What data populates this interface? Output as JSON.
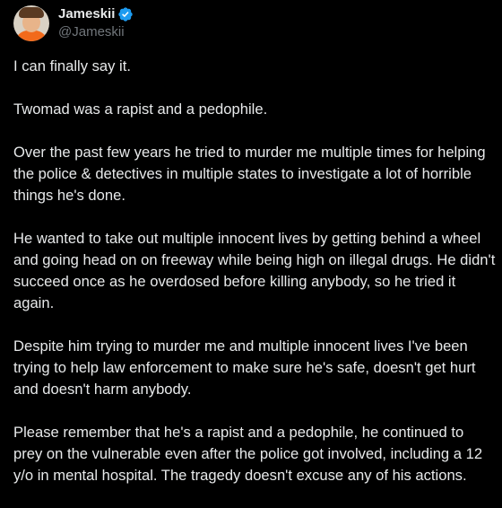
{
  "author": {
    "display_name": "Jameskii",
    "handle": "@Jameskii",
    "verified_icon": "verified-badge-icon",
    "verified_color": "#1d9bf0"
  },
  "tweet": {
    "paragraphs": [
      [
        "I can finally say it."
      ],
      [
        "Twomad was a rapist and a pedophile."
      ],
      [
        "Over the past few years he tried to murder me multiple times for helping",
        "the police & detectives in multiple states to investigate a lot of horrible",
        "things he's done."
      ],
      [
        "He wanted to take out multiple innocent lives by getting behind a wheel",
        "and going head on on freeway while being high on illegal drugs. He didn't",
        "succeed once as he overdosed before killing anybody, so he tried it",
        "again."
      ],
      [
        "Despite him trying to murder me and multiple innocent lives I've been",
        "trying to help law enforcement to make sure he's safe, doesn't get hurt",
        "and doesn't harm anybody."
      ],
      [
        "Please remember that he's a rapist and a pedophile, he continued to",
        "prey on the vulnerable even after the police got involved, including a 12",
        "y/o in mental hospital. The tragedy doesn't excuse any of his actions."
      ]
    ]
  },
  "colors": {
    "background": "#000000",
    "text": "#e7e9ea",
    "secondary_text": "#71767b"
  }
}
